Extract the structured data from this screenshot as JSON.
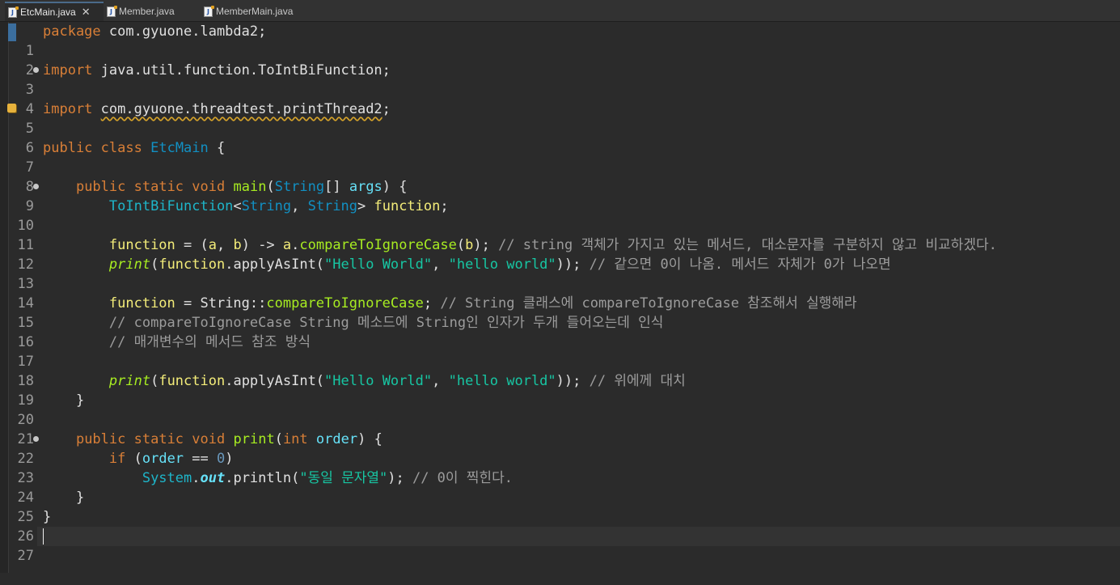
{
  "tabs": [
    {
      "label": "EtcMain.java",
      "active": true,
      "icon": "java-file-icon"
    },
    {
      "label": "Member.java",
      "active": false,
      "icon": "java-file-icon"
    },
    {
      "label": "MemberMain.java",
      "active": false,
      "icon": "java-file-icon"
    }
  ],
  "editor": {
    "line_numbers": [
      "1",
      "2",
      "3",
      "4",
      "5",
      "6",
      "7",
      "8",
      "9",
      "10",
      "11",
      "12",
      "13",
      "14",
      "15",
      "16",
      "17",
      "18",
      "19",
      "20",
      "21",
      "22",
      "23",
      "24",
      "25",
      "26",
      "27"
    ],
    "code": {
      "l1": {
        "kw_package": "package",
        "pkg": " com.gyuone.lambda2;"
      },
      "l3": {
        "kw_import": "import",
        "path": " java.util.function.ToIntBiFunction;"
      },
      "l5": {
        "kw_import": "import",
        "path": "com.gyuone.threadtest.printThread2",
        "semi": ";"
      },
      "l7": {
        "kw_public": "public",
        "kw_class": "class",
        "name": "EtcMain",
        "brace": " {"
      },
      "l9": {
        "kw_public": "public",
        "kw_static": "static",
        "kw_void": "void",
        "method": "main",
        "open": "(",
        "type": "String",
        "arr": "[] ",
        "param": "args",
        "close": ") {"
      },
      "l10": {
        "type1": "ToIntBiFunction",
        "lt": "<",
        "type2": "String",
        "comma": ", ",
        "type3": "String",
        "gt": "> ",
        "var": "function",
        "semi": ";"
      },
      "l12": {
        "var": "function",
        "eq": " = (",
        "a": "a",
        "c": ", ",
        "b": "b",
        "arrow": ") -> ",
        "a2": "a",
        "dot": ".",
        "m": "compareToIgnoreCase",
        "open": "(",
        "b2": "b",
        "close": "); ",
        "comment": "// string 객체가 가지고 있는 메서드, 대소문자를 구분하지 않고 비교하겠다."
      },
      "l13": {
        "print": "print",
        "open": "(",
        "var": "function",
        "call": ".applyAsInt(",
        "s1": "\"Hello World\"",
        "comma": ", ",
        "s2": "\"hello world\"",
        "close": ")); ",
        "comment": "// 같으면 0이 나옴. 메서드 자체가 0가 나오면"
      },
      "l15": {
        "var": "function",
        "eq": " = String::",
        "m": "compareToIgnoreCase",
        "semi": "; ",
        "comment": "// String 클래스에 compareToIgnoreCase 참조해서 실행해라"
      },
      "l16": {
        "comment": "// compareToIgnoreCase String 메소드에 String인 인자가 두개 들어오는데 인식"
      },
      "l17": {
        "comment": "// 매개변수의 메서드 참조 방식"
      },
      "l19": {
        "print": "print",
        "open": "(",
        "var": "function",
        "call": ".applyAsInt(",
        "s1": "\"Hello World\"",
        "comma": ", ",
        "s2": "\"hello world\"",
        "close": ")); ",
        "comment": "// 위에께 대치"
      },
      "l20": {
        "brace": "}"
      },
      "l22": {
        "kw_public": "public",
        "kw_static": "static",
        "kw_void": "void",
        "method": "print",
        "open": "(",
        "kw_int": "int",
        "param": "order",
        "close": ") {"
      },
      "l23": {
        "kw_if": "if",
        "open": " (",
        "param": "order",
        "op": " == ",
        "num": "0",
        "close": ")"
      },
      "l24": {
        "cls": "System",
        "dot": ".",
        "field": "out",
        "call": ".println(",
        "str": "\"동일 문자열\"",
        "close": "); ",
        "comment": "// 0이 찍힌다."
      },
      "l25": {
        "brace": "}"
      },
      "l26": {
        "brace": "}"
      }
    }
  },
  "colors": {
    "background": "#2b2b2b",
    "keyword": "#d97f37",
    "type": "#1290c3",
    "string": "#17c6a3",
    "comment": "#9c9c9c",
    "method_declaration": "#a7ec21",
    "variable": "#f3ec79"
  }
}
